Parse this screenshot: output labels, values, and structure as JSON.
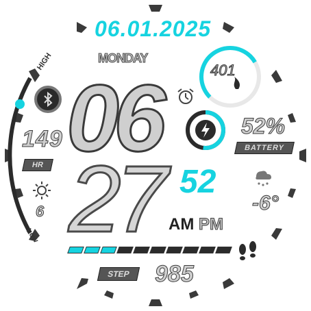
{
  "date": "06.01.2025",
  "weekday": "MONDAY",
  "time": {
    "hour": "06",
    "minute": "27",
    "seconds": "52",
    "am": "AM",
    "pm": "PM"
  },
  "heart_rate": {
    "value": "149",
    "label": "HR"
  },
  "uv": {
    "value": "6"
  },
  "calories": {
    "value": "401",
    "progress": 0.72
  },
  "battery": {
    "percent": "52%",
    "label": "BATTERY",
    "level": 0.52
  },
  "weather": {
    "temperature": "-6°"
  },
  "steps": {
    "label": "STEP",
    "value": "985",
    "progress_segments": 3,
    "total_segments": 10
  },
  "range_labels": {
    "high": "HIGH",
    "low": "Low"
  },
  "colors": {
    "accent": "#16d3e0",
    "dark": "#2b2b2b",
    "grey": "#9a9a9a"
  },
  "icons": [
    "bluetooth-icon",
    "alarm-icon",
    "lightning-icon",
    "flame-icon",
    "sun-icon",
    "cloud-snow-icon",
    "footprints-icon"
  ]
}
